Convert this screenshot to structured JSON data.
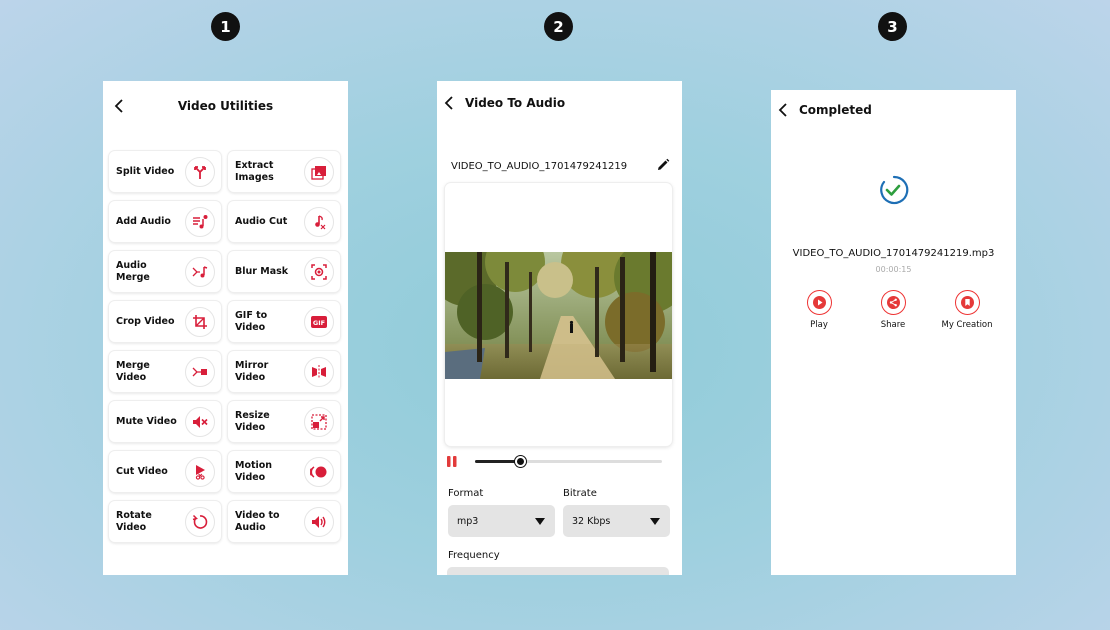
{
  "steps": [
    "1",
    "2",
    "3"
  ],
  "screen1": {
    "title": "Video Utilities",
    "tools": [
      {
        "label": "Split Video",
        "icon": "split-icon"
      },
      {
        "label": "Extract Images",
        "icon": "image-icon"
      },
      {
        "label": "Add Audio",
        "icon": "add-music-icon"
      },
      {
        "label": "Audio Cut",
        "icon": "audio-cut-icon"
      },
      {
        "label": "Audio Merge",
        "icon": "audio-merge-icon"
      },
      {
        "label": "Blur Mask",
        "icon": "blur-mask-icon"
      },
      {
        "label": "Crop Video",
        "icon": "crop-icon"
      },
      {
        "label": "GIF to Video",
        "icon": "gif-icon"
      },
      {
        "label": "Merge Video",
        "icon": "merge-icon"
      },
      {
        "label": "Mirror Video",
        "icon": "mirror-icon"
      },
      {
        "label": "Mute Video",
        "icon": "mute-icon"
      },
      {
        "label": "Resize Video",
        "icon": "resize-icon"
      },
      {
        "label": "Cut Video",
        "icon": "cut-video-icon"
      },
      {
        "label": "Motion Video",
        "icon": "motion-icon"
      },
      {
        "label": "Rotate Video",
        "icon": "rotate-icon"
      },
      {
        "label": "Video to Audio",
        "icon": "volume-icon"
      }
    ]
  },
  "screen2": {
    "title": "Video To Audio",
    "file_name": "VIDEO_TO_AUDIO_1701479241219",
    "progress": 0.24,
    "format": {
      "label": "Format",
      "value": "mp3"
    },
    "bitrate": {
      "label": "Bitrate",
      "value": "32 Kbps"
    },
    "frequency": {
      "label": "Frequency"
    }
  },
  "screen3": {
    "title": "Completed",
    "output_name": "VIDEO_TO_AUDIO_1701479241219.mp3",
    "duration": "00:00:15",
    "actions": [
      {
        "label": "Play",
        "icon": "play-icon"
      },
      {
        "label": "Share",
        "icon": "share-icon"
      },
      {
        "label": "My Creation",
        "icon": "bookmark-icon"
      }
    ]
  },
  "colors": {
    "accent": "#d81e3a",
    "check_green": "#2e9e3e",
    "check_blue": "#1e6fb5"
  }
}
